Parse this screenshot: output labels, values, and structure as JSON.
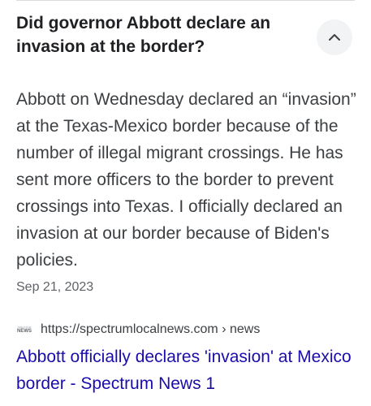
{
  "faq": {
    "question": "Did governor Abbott declare an invasion at the border?",
    "toggle_icon": "chevron-up-icon",
    "answer": "Abbott on Wednesday declared an “invasion” at the Texas-Mexico border because of the number of illegal migrant crossings. He has sent more officers to the border to prevent crossings into Texas. I officially declared an invasion at our border because of Biden's policies.",
    "date": "Sep 21, 2023"
  },
  "source": {
    "favicon_top": "SPECTRUM",
    "favicon_main": "NEWS",
    "url": "https://spectrumlocalnews.com › news",
    "title": "Abbott officially declares 'invasion' at Mexico border - Spectrum News 1"
  },
  "colors": {
    "link": "#1a0dab",
    "text": "#202124",
    "secondary": "#5f6368",
    "button_bg": "#f1f3f4"
  }
}
